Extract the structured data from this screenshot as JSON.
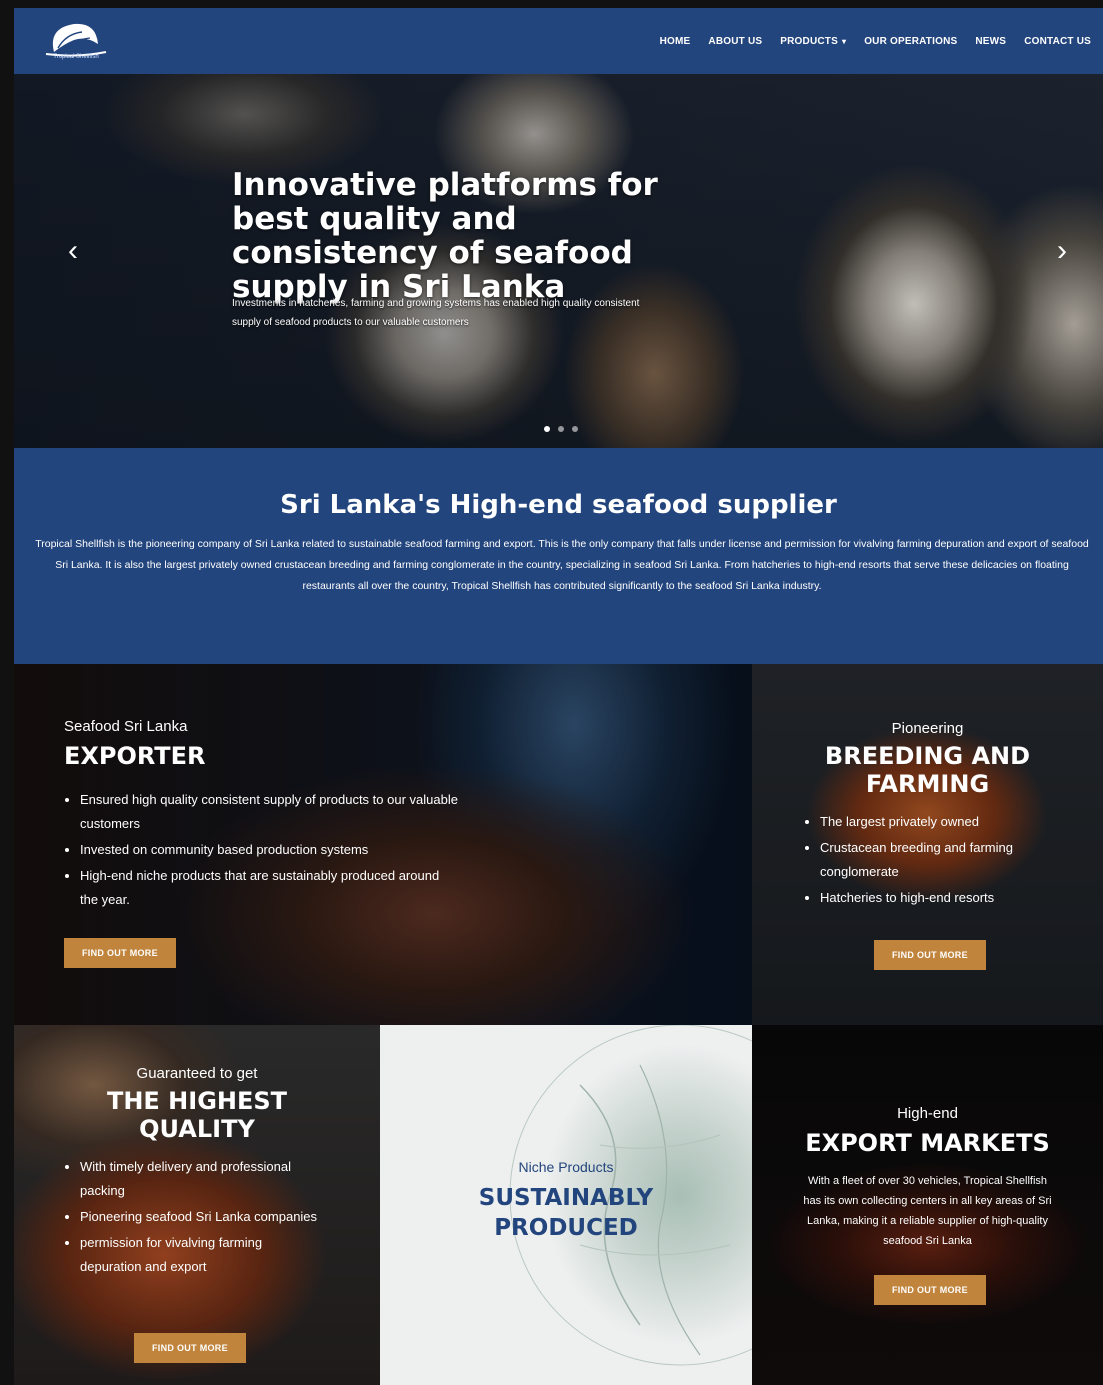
{
  "nav": {
    "logo_caption": "Tropical Shellfish",
    "items": [
      {
        "label": "HOME"
      },
      {
        "label": "ABOUT US"
      },
      {
        "label": "PRODUCTS"
      },
      {
        "label": "OUR OPERATIONS"
      },
      {
        "label": "NEWS"
      },
      {
        "label": "CONTACT US"
      }
    ],
    "products_caret": "▾"
  },
  "hero": {
    "title": "Innovative platforms for best quality and consistency of seafood supply in Sri Lanka",
    "subtitle": "Investments in hatcheries, farming and growing systems has enabled high quality consistent supply of seafood products to our valuable customers",
    "prev": "‹",
    "next": "›",
    "slides": 3,
    "active_slide": 1
  },
  "intro": {
    "title": "Sri Lanka's High-end seafood supplier",
    "text": "Tropical Shellfish is the pioneering company of Sri Lanka related to sustainable seafood farming and export. This is the only company that falls under license and permission for vivalving farming depuration and export of seafood Sri Lanka. It is also the largest privately owned crustacean breeding and farming conglomerate in the country, specializing in seafood Sri Lanka. From hatcheries to high-end resorts that serve these delicacies on floating restaurants all over the country, Tropical Shellfish has contributed significantly to the seafood Sri Lanka industry."
  },
  "cards": {
    "exporter": {
      "kicker": "Seafood Sri Lanka",
      "heading": "EXPORTER",
      "bullets": [
        "Ensured high quality consistent supply of products to our valuable customers",
        "Invested on community based production systems",
        "High-end niche products that are sustainably produced around the year."
      ],
      "button": "FIND OUT MORE"
    },
    "breeding": {
      "kicker": "Pioneering",
      "heading": "BREEDING AND FARMING",
      "bullets": [
        "The largest privately owned",
        "Crustacean breeding and farming conglomerate",
        "Hatcheries to high-end resorts"
      ],
      "button": "FIND OUT MORE"
    },
    "quality": {
      "kicker": "Guaranteed to get",
      "heading": "THE HIGHEST QUALITY",
      "bullets": [
        "With timely delivery and professional packing",
        "Pioneering seafood Sri Lanka companies",
        "permission for vivalving farming depuration and export"
      ],
      "button": "FIND OUT MORE"
    },
    "sustain": {
      "kicker": "Niche Products",
      "heading": "SUSTAINABLY PRODUCED"
    },
    "markets": {
      "kicker": "High-end",
      "heading": "EXPORT MARKETS",
      "text": "With a fleet of over 30 vehicles, Tropical Shellfish has its own collecting centers in all key areas of Sri Lanka, making it a reliable supplier of high-quality seafood Sri Lanka",
      "button": "FIND OUT MORE"
    }
  },
  "colors": {
    "brand_blue": "#23457d",
    "button_gold": "#c0843c",
    "sustain_heading": "#23457d"
  }
}
